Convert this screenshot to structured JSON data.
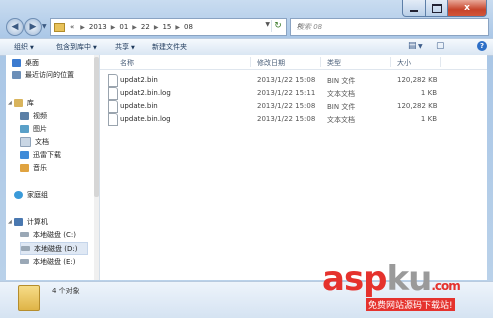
{
  "window": {
    "minimize": "",
    "maximize": "",
    "close": "x"
  },
  "address": {
    "crumbs": [
      "«",
      "2013",
      "01",
      "22",
      "15",
      "08"
    ],
    "search_placeholder": "搜索 08"
  },
  "toolbar": {
    "organize": "组织",
    "include": "包含到库中",
    "share": "共享",
    "new_folder": "新建文件夹"
  },
  "nav": {
    "desktop": "桌面",
    "recent": "最近访问的位置",
    "libraries": "库",
    "videos": "视频",
    "pictures": "图片",
    "documents": "文档",
    "xunlei": "迅雷下载",
    "music": "音乐",
    "homegroup": "家庭组",
    "computer": "计算机",
    "disk_c": "本地磁盘 (C:)",
    "disk_d": "本地磁盘 (D:)",
    "disk_e": "本地磁盘 (E:)"
  },
  "columns": {
    "name": "名称",
    "date": "修改日期",
    "type": "类型",
    "size": "大小"
  },
  "files": [
    {
      "name": "updat2.bin",
      "date": "2013/1/22 15:08",
      "type": "BIN 文件",
      "size": "120,282 KB"
    },
    {
      "name": "updat2.bin.log",
      "date": "2013/1/22 15:11",
      "type": "文本文档",
      "size": "1 KB"
    },
    {
      "name": "update.bin",
      "date": "2013/1/22 15:08",
      "type": "BIN 文件",
      "size": "120,282 KB"
    },
    {
      "name": "update.bin.log",
      "date": "2013/1/22 15:08",
      "type": "文本文档",
      "size": "1 KB"
    }
  ],
  "details": {
    "count": "4 个对象"
  },
  "watermark": {
    "brand_a": "asp",
    "brand_b": "ku",
    ".com": ".com",
    "tagline": "免费网站源码下载站!"
  }
}
